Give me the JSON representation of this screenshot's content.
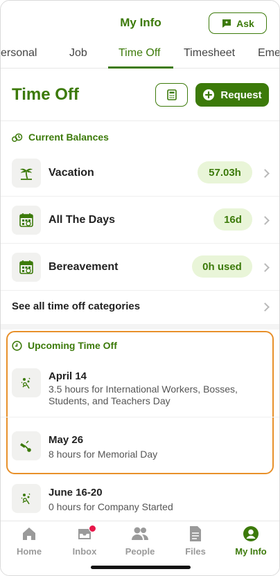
{
  "header": {
    "title": "My Info",
    "ask_label": "Ask"
  },
  "tabs": [
    {
      "label": "ersonal"
    },
    {
      "label": "Job"
    },
    {
      "label": "Time Off"
    },
    {
      "label": "Timesheet"
    },
    {
      "label": "Eme"
    }
  ],
  "page": {
    "title": "Time Off",
    "request_label": "Request"
  },
  "balances": {
    "section_title": "Current Balances",
    "items": [
      {
        "label": "Vacation",
        "value": "57.03h",
        "icon": "palm-tree-icon"
      },
      {
        "label": "All The Days",
        "value": "16d",
        "icon": "calendar-icon"
      },
      {
        "label": "Bereavement",
        "value": "0h used",
        "icon": "calendar-icon"
      }
    ],
    "see_all_label": "See all time off categories"
  },
  "upcoming": {
    "section_title": "Upcoming Time Off",
    "items": [
      {
        "date": "April 14",
        "desc": "3.5 hours for International Workers, Bosses, Students, and Teachers Day",
        "icon": "party-icon"
      },
      {
        "date": "May 26",
        "desc": "8 hours for Memorial Day",
        "icon": "flag-icon"
      },
      {
        "date": "June 16-20",
        "desc": "0 hours for Company Started",
        "icon": "party-icon"
      }
    ]
  },
  "bottom_nav": [
    {
      "label": "Home",
      "icon": "home-icon"
    },
    {
      "label": "Inbox",
      "icon": "inbox-icon"
    },
    {
      "label": "People",
      "icon": "people-icon"
    },
    {
      "label": "Files",
      "icon": "files-icon"
    },
    {
      "label": "My Info",
      "icon": "person-circle-icon"
    }
  ],
  "colors": {
    "brand_green": "#3c7a0a",
    "pill_bg": "#e9f5d8",
    "highlight_orange": "#e8902a",
    "notification_red": "#e8174a"
  }
}
